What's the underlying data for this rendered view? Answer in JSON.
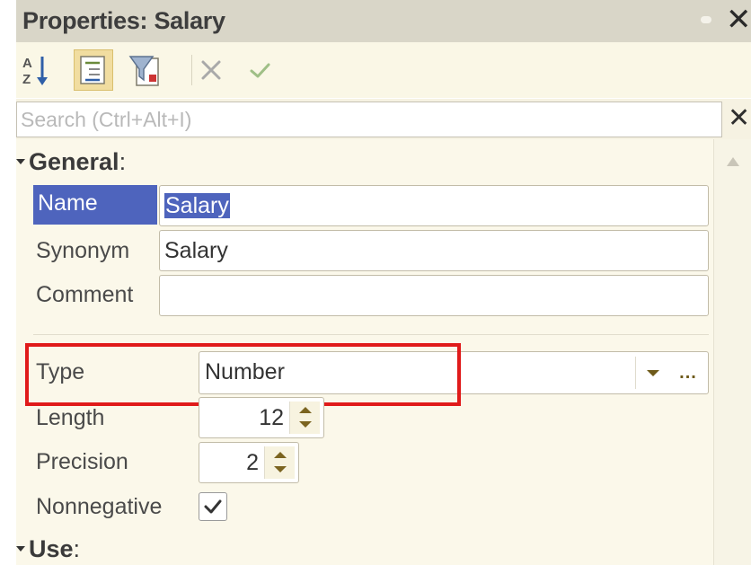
{
  "panel": {
    "title": "Properties: Salary"
  },
  "toolbar": {
    "sort_icon": "sort-az-icon",
    "categorize_icon": "categories-icon",
    "filter_icon": "filter-icon",
    "cancel_icon": "cancel-icon",
    "apply_icon": "checkmark-icon"
  },
  "search": {
    "placeholder": "Search (Ctrl+Alt+I)",
    "value": ""
  },
  "sections": {
    "general": "General",
    "use": "Use"
  },
  "fields": {
    "name_label": "Name",
    "name_value": "Salary",
    "synonym_label": "Synonym",
    "synonym_value": "Salary",
    "comment_label": "Comment",
    "comment_value": "",
    "type_label": "Type",
    "type_value": "Number",
    "type_ellipsis": "...",
    "length_label": "Length",
    "length_value": "12",
    "precision_label": "Precision",
    "precision_value": "2",
    "nonnegative_label": "Nonnegative",
    "nonnegative_checked": true
  },
  "colors": {
    "selection": "#4e64bd",
    "highlight_box": "#e01a1a",
    "pressed_button": "#f1dda0",
    "panel_background": "#fbf8ea"
  }
}
